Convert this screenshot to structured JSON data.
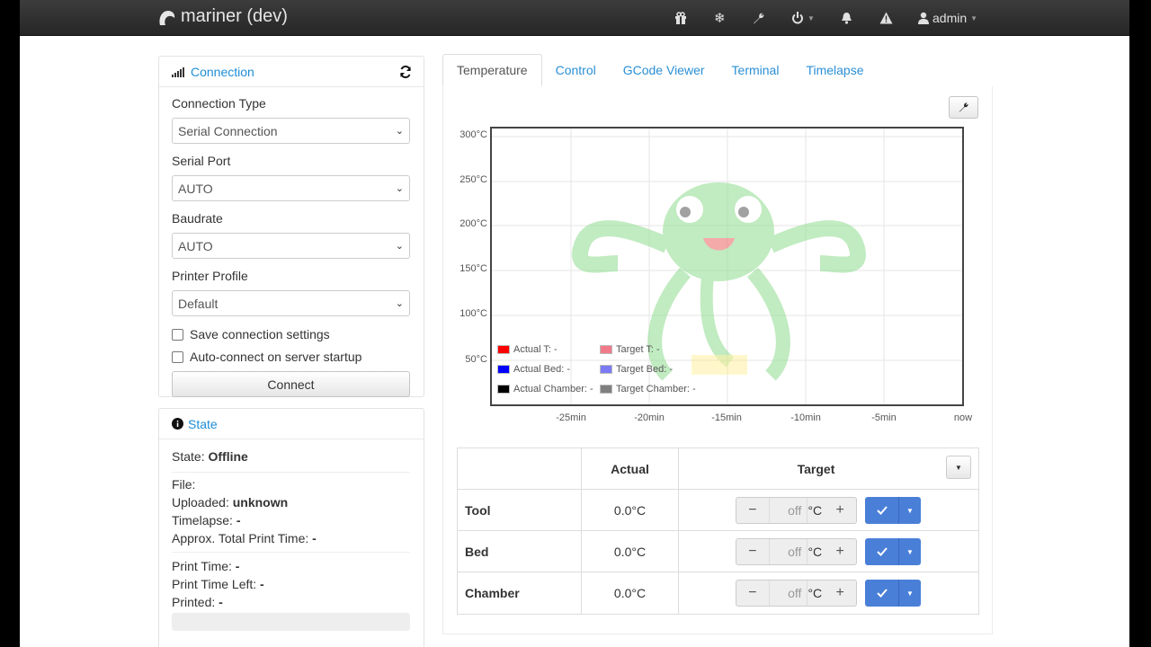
{
  "navbar": {
    "brand": "mariner (dev)",
    "user": "admin",
    "icons": [
      "gift-icon",
      "snowflake-icon",
      "wrench-icon",
      "power-icon",
      "bell-icon",
      "warning-icon",
      "user-icon"
    ]
  },
  "connection": {
    "title": "Connection",
    "connection_type_label": "Connection Type",
    "connection_type_value": "Serial Connection",
    "serial_port_label": "Serial Port",
    "serial_port_value": "AUTO",
    "baudrate_label": "Baudrate",
    "baudrate_value": "AUTO",
    "profile_label": "Printer Profile",
    "profile_value": "Default",
    "save_settings_label": "Save connection settings",
    "autoconnect_label": "Auto-connect on server startup",
    "connect_button": "Connect"
  },
  "state": {
    "title": "State",
    "state_label": "State:",
    "state_value": "Offline",
    "file_label": "File:",
    "uploaded_label": "Uploaded:",
    "uploaded_value": "unknown",
    "timelapse_label": "Timelapse:",
    "timelapse_value": "-",
    "approx_label": "Approx. Total Print Time:",
    "approx_value": "-",
    "print_time_label": "Print Time:",
    "print_time_value": "-",
    "time_left_label": "Print Time Left:",
    "time_left_value": "-",
    "printed_label": "Printed:",
    "printed_value": "-"
  },
  "tabs": [
    "Temperature",
    "Control",
    "GCode Viewer",
    "Terminal",
    "Timelapse"
  ],
  "chart_data": {
    "type": "line",
    "ylabels": [
      "300°C",
      "250°C",
      "200°C",
      "150°C",
      "100°C",
      "50°C"
    ],
    "xlabels": [
      "-25min",
      "-20min",
      "-15min",
      "-10min",
      "-5min",
      "now"
    ],
    "legend": [
      {
        "label": "Actual T: -",
        "color": "#ff0000"
      },
      {
        "label": "Target T: -",
        "color": "#f07a8a"
      },
      {
        "label": "Actual Bed: -",
        "color": "#0000ff"
      },
      {
        "label": "Target Bed: -",
        "color": "#7b7bf5"
      },
      {
        "label": "Actual Chamber: -",
        "color": "#000000"
      },
      {
        "label": "Target Chamber: -",
        "color": "#808080"
      }
    ],
    "series": []
  },
  "temps": {
    "col_actual": "Actual",
    "col_target": "Target",
    "unit": "°C",
    "off": "off",
    "rows": [
      {
        "name": "Tool",
        "actual": "0.0°C"
      },
      {
        "name": "Bed",
        "actual": "0.0°C"
      },
      {
        "name": "Chamber",
        "actual": "0.0°C"
      }
    ]
  }
}
